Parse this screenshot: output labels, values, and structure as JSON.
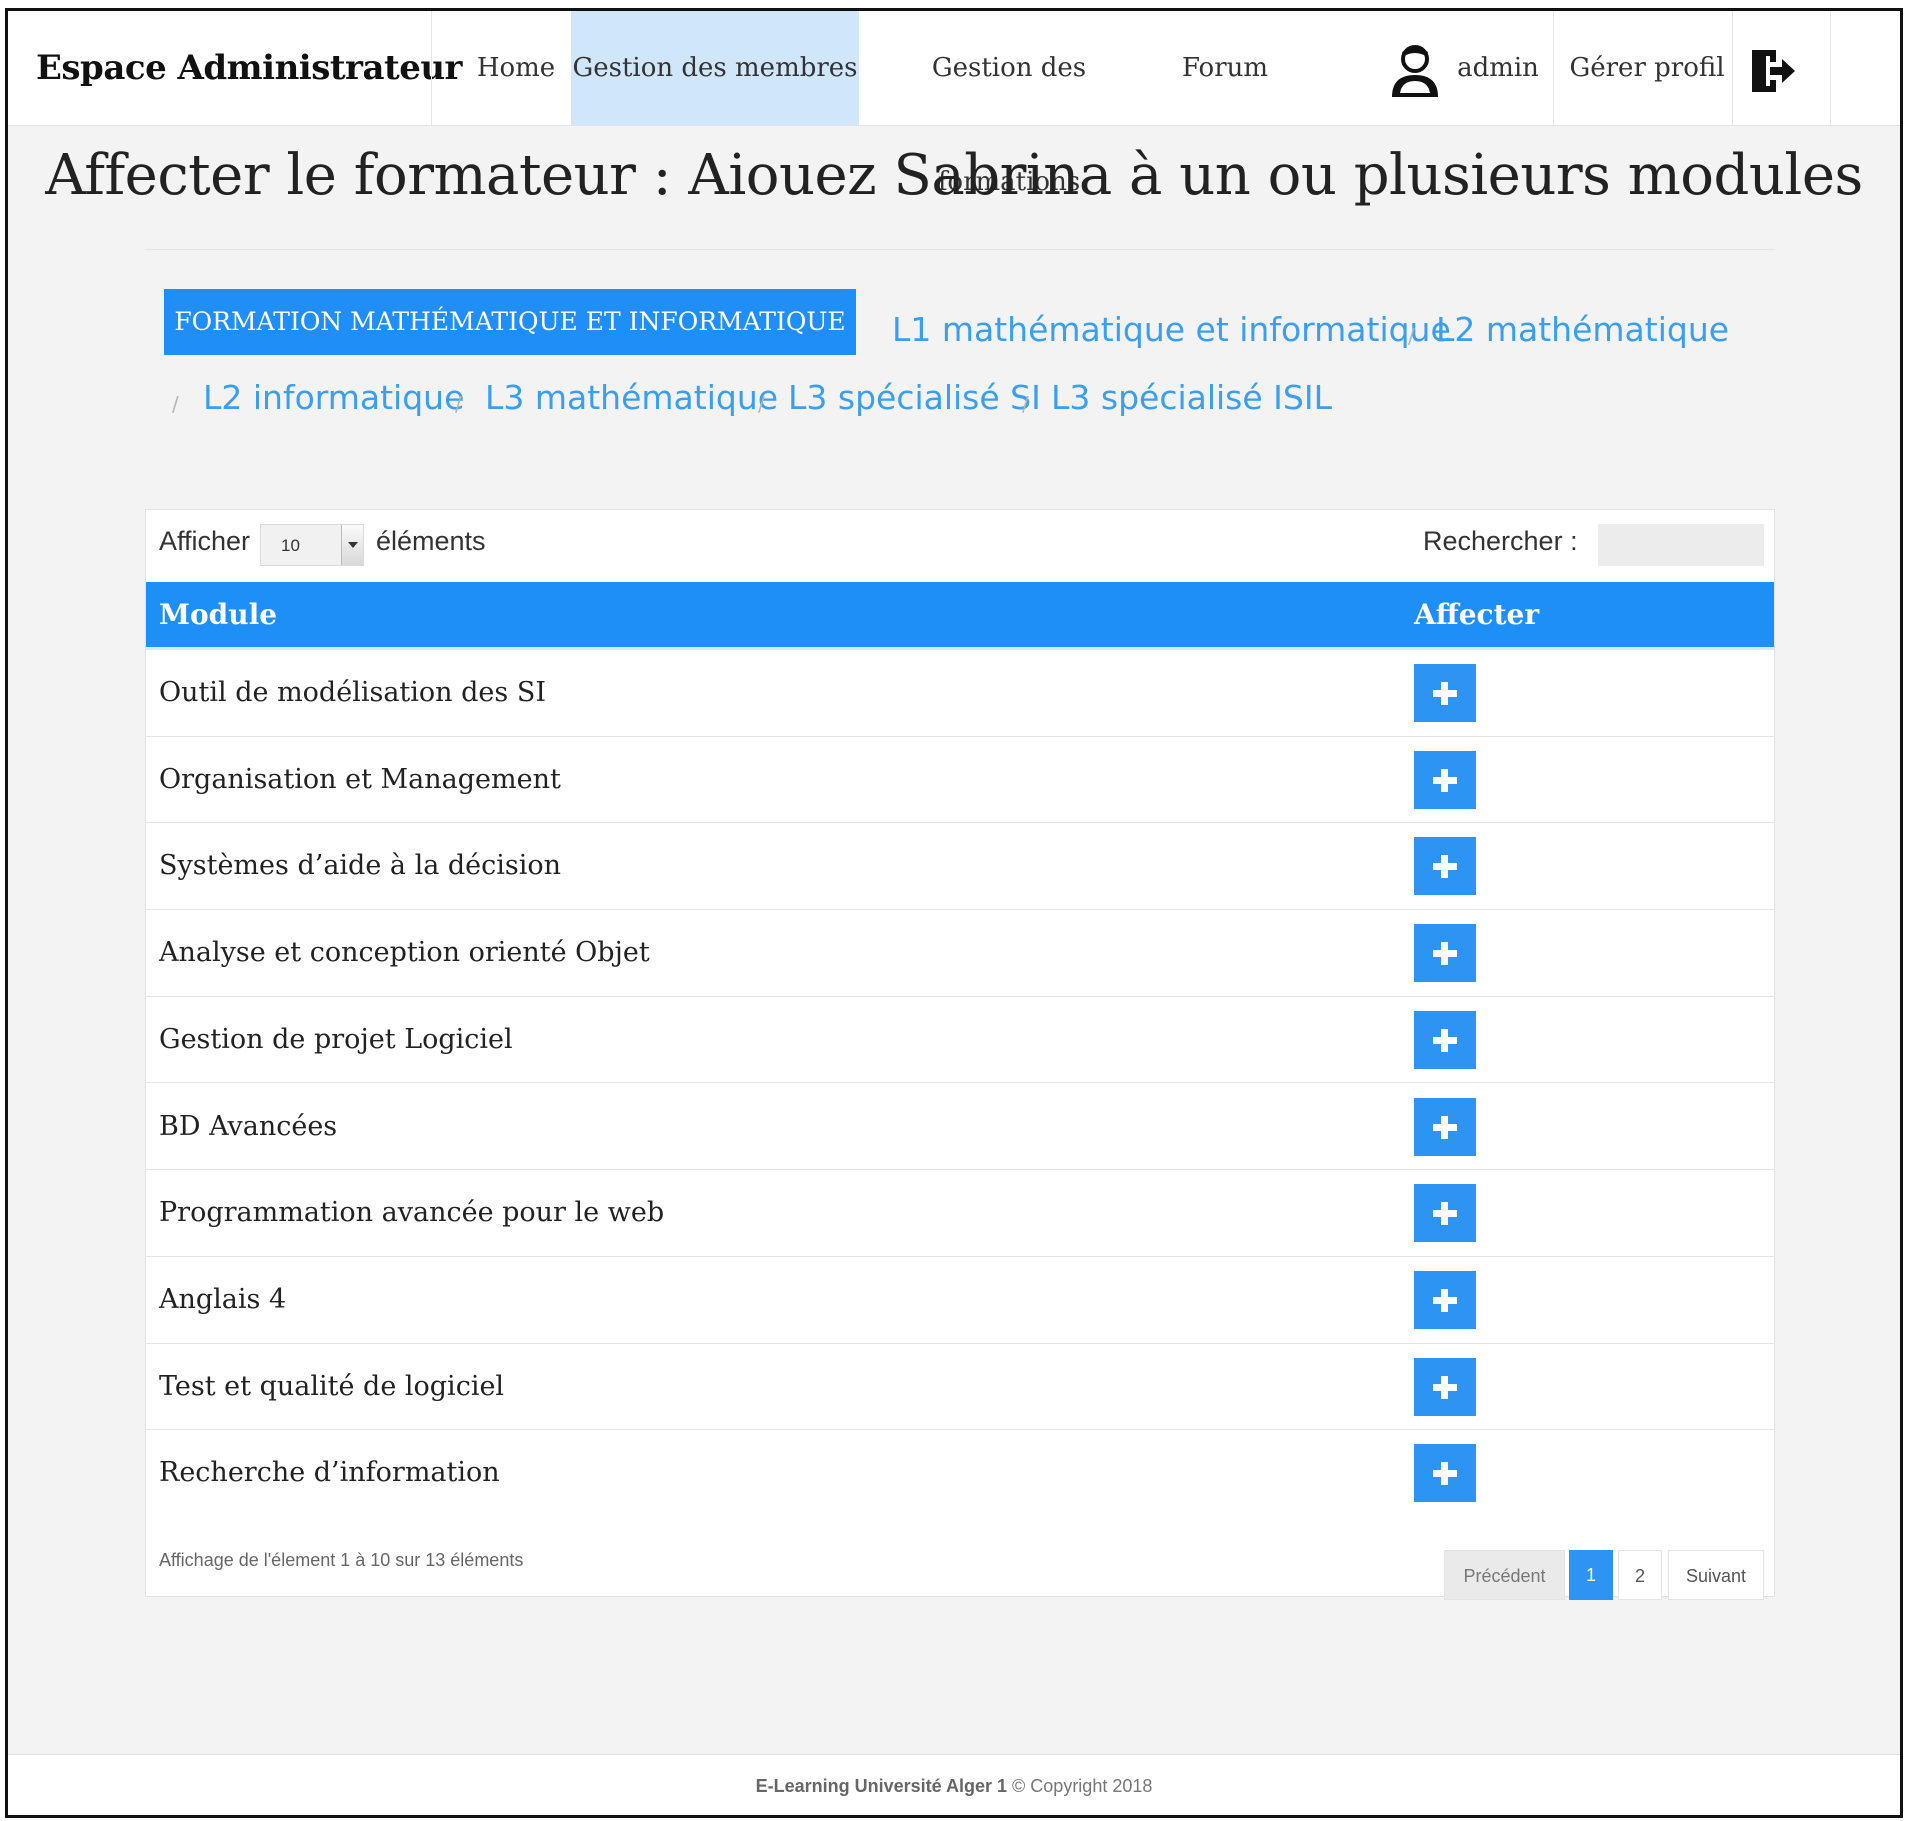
{
  "navbar": {
    "brand": "Espace Administrateur",
    "items": [
      {
        "label": "Home",
        "active": false
      },
      {
        "label": "Gestion des membres",
        "active": true
      },
      {
        "label": "Gestion des formations",
        "active": false
      },
      {
        "label": "Forum",
        "active": false
      }
    ],
    "user": {
      "icon": "user-icon",
      "name": "admin"
    },
    "profile_label": "Gérer profil",
    "logout_icon": "logout-icon"
  },
  "page": {
    "title": "Affecter le formateur : Aiouez Sabrina à un ou plusieurs modules"
  },
  "breadcrumb": {
    "active": "FORMATION MATHÉMATIQUE ET INFORMATIQUE",
    "links": [
      "L1 mathématique et informatique",
      "L2 mathématique",
      "L2 informatique",
      "L3 mathématique",
      "L3 spécialisé SI",
      "L3 spécialisé ISIL"
    ],
    "separator": "/"
  },
  "table": {
    "length_label_before": "Afficher",
    "length_value": "10",
    "length_label_after": "éléments",
    "search_label": "Rechercher :",
    "search_value": "",
    "columns": [
      "Module",
      "Affecter"
    ],
    "rows": [
      "Outil de modélisation des SI",
      "Organisation et Management",
      "Systèmes d’aide à la décision",
      "Analyse et conception orienté Objet",
      "Gestion de projet Logiciel",
      "BD Avancées",
      "Programmation avancée pour le web",
      "Anglais 4",
      "Test et qualité de logiciel",
      "Recherche d’information"
    ],
    "add_icon": "plus-icon",
    "info": "Affichage de l'élement 1 à 10 sur 13 éléments",
    "pagination": {
      "prev": "Précédent",
      "pages": [
        "1",
        "2"
      ],
      "current": "1",
      "next": "Suivant"
    }
  },
  "footer": {
    "site": "E-Learning Université Alger 1",
    "copyright": "© Copyright 2018"
  },
  "colors": {
    "accent": "#1f8ff7",
    "active_nav": "#cfe6fb",
    "link": "#3a9ff0"
  }
}
